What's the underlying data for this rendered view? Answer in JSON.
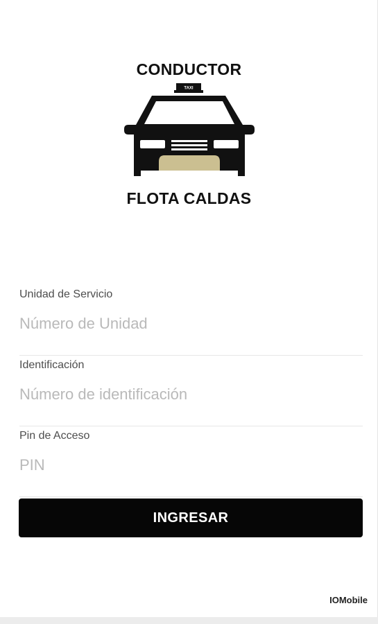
{
  "logo": {
    "top_text": "CONDUCTOR",
    "bottom_text": "FLOTA CALDAS",
    "sign_text": "TAXI",
    "icon": "taxi-icon",
    "accent_color": "#cbbf91"
  },
  "form": {
    "unit": {
      "label": "Unidad de Servicio",
      "placeholder": "Número de Unidad",
      "value": ""
    },
    "identification": {
      "label": "Identificación",
      "placeholder": "Número de identificación",
      "value": ""
    },
    "pin": {
      "label": "Pin de Acceso",
      "placeholder": "PIN",
      "value": ""
    },
    "submit_label": "INGRESAR"
  },
  "footer": {
    "brand": "IOMobile"
  },
  "colors": {
    "button_bg": "#060606",
    "button_text": "#ffffff",
    "placeholder": "#b9b9b9",
    "label": "#4d4d4d"
  }
}
